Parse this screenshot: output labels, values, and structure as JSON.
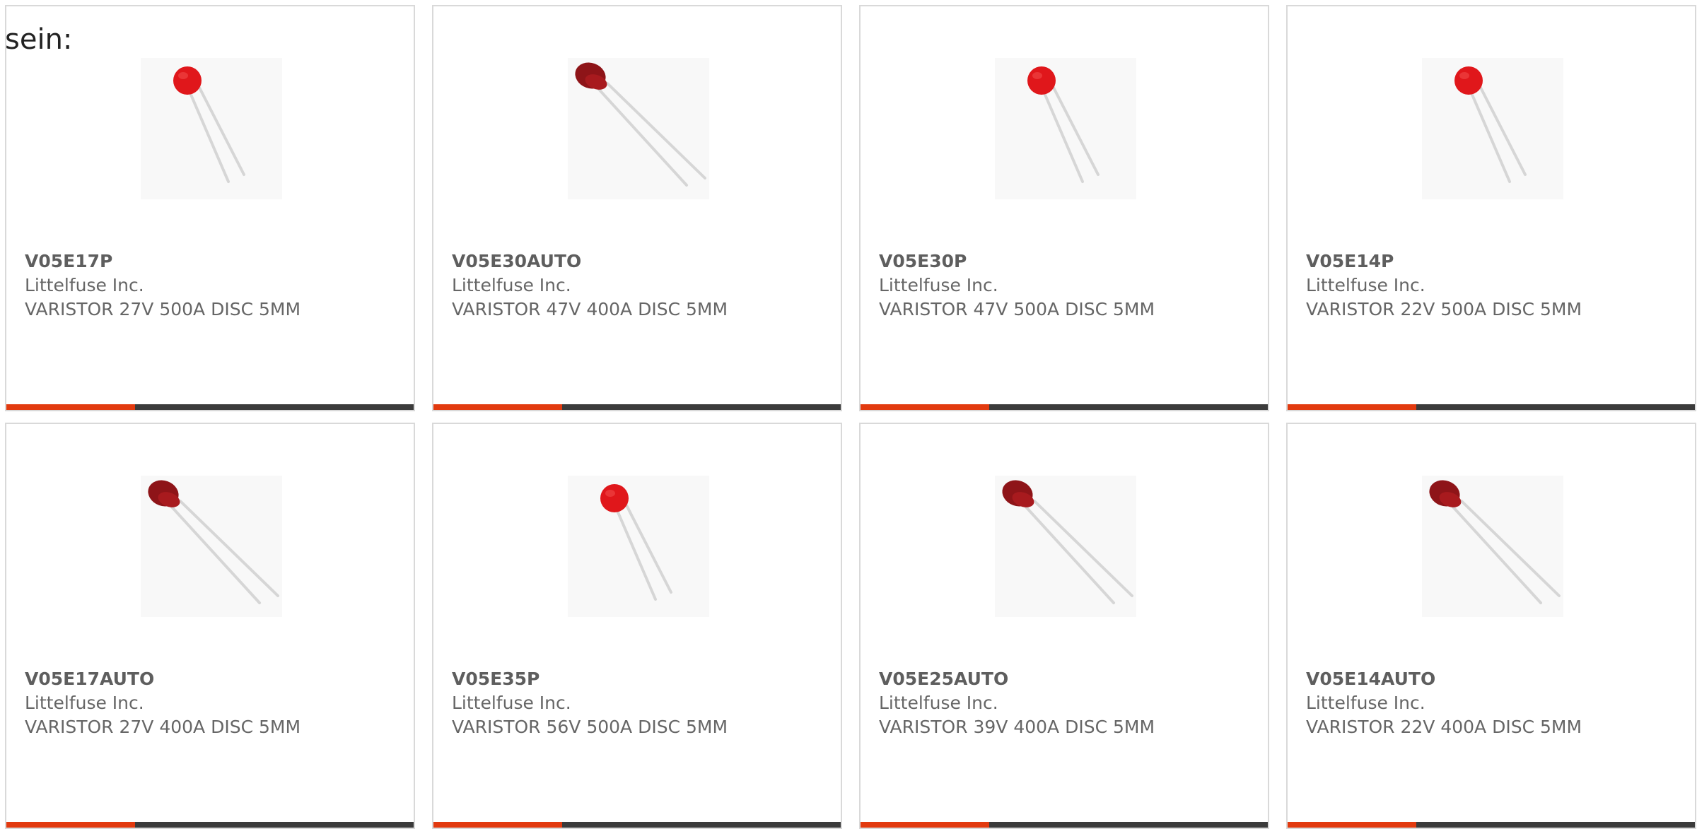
{
  "intro_text": "sein:",
  "colors": {
    "card_border": "#d9d9d9",
    "accent_bar": "#e23a0f",
    "dark_bar": "#3b3b3b",
    "text": "#666666"
  },
  "products": [
    {
      "part": "V05E17P",
      "manufacturer": "Littelfuse Inc.",
      "description": "VARISTOR 27V 500A DISC 5MM",
      "image": "red-varistor-icon"
    },
    {
      "part": "V05E30AUTO",
      "manufacturer": "Littelfuse Inc.",
      "description": "VARISTOR 47V 400A DISC 5MM",
      "image": "dark-red-varistor-icon"
    },
    {
      "part": "V05E30P",
      "manufacturer": "Littelfuse Inc.",
      "description": "VARISTOR 47V 500A DISC 5MM",
      "image": "red-varistor-icon"
    },
    {
      "part": "V05E14P",
      "manufacturer": "Littelfuse Inc.",
      "description": "VARISTOR 22V 500A DISC 5MM",
      "image": "red-varistor-icon"
    },
    {
      "part": "V05E17AUTO",
      "manufacturer": "Littelfuse Inc.",
      "description": "VARISTOR 27V 400A DISC 5MM",
      "image": "dark-red-varistor-icon"
    },
    {
      "part": "V05E35P",
      "manufacturer": "Littelfuse Inc.",
      "description": "VARISTOR 56V 500A DISC 5MM",
      "image": "red-varistor-icon"
    },
    {
      "part": "V05E25AUTO",
      "manufacturer": "Littelfuse Inc.",
      "description": "VARISTOR 39V 400A DISC 5MM",
      "image": "dark-red-varistor-icon"
    },
    {
      "part": "V05E14AUTO",
      "manufacturer": "Littelfuse Inc.",
      "description": "VARISTOR 22V 400A DISC 5MM",
      "image": "dark-red-varistor-icon"
    }
  ]
}
